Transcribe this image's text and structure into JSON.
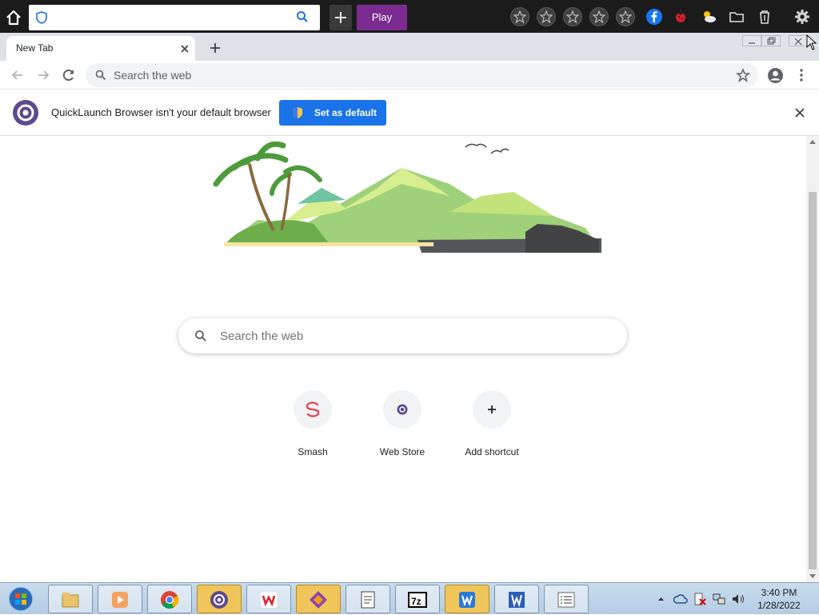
{
  "launcher": {
    "play_label": "Play",
    "icons": [
      "home-icon",
      "shield-icon",
      "search-icon",
      "plus-icon",
      "star-icon",
      "star-icon",
      "star-icon",
      "star-icon",
      "star-icon",
      "facebook-icon",
      "ladybug-icon",
      "weather-icon",
      "folder-icon",
      "trash-icon",
      "gear-icon"
    ]
  },
  "tab": {
    "title": "New Tab"
  },
  "toolbar": {
    "omnibox_placeholder": "Search the web"
  },
  "infobar": {
    "message": "QuickLaunch Browser isn't your default browser",
    "button_label": "Set as default"
  },
  "ntp": {
    "search_placeholder": "Search the web",
    "shortcuts": [
      {
        "label": "Smash",
        "icon": "smash-icon"
      },
      {
        "label": "Web Store",
        "icon": "web-store-icon"
      },
      {
        "label": "Add shortcut",
        "icon": "plus-icon"
      }
    ]
  },
  "taskbar": {
    "apps": [
      "file-explorer",
      "media-player",
      "chrome",
      "quicklaunch-browser",
      "wps-office",
      "game-app",
      "text-document",
      "7zip",
      "wps-writer",
      "word",
      "notepad-list"
    ],
    "clock_time": "3:40 PM",
    "clock_date": "1/28/2022"
  },
  "colors": {
    "play": "#7b2b8f",
    "set_default": "#1a73e8",
    "brand": "#5c4a8f"
  }
}
